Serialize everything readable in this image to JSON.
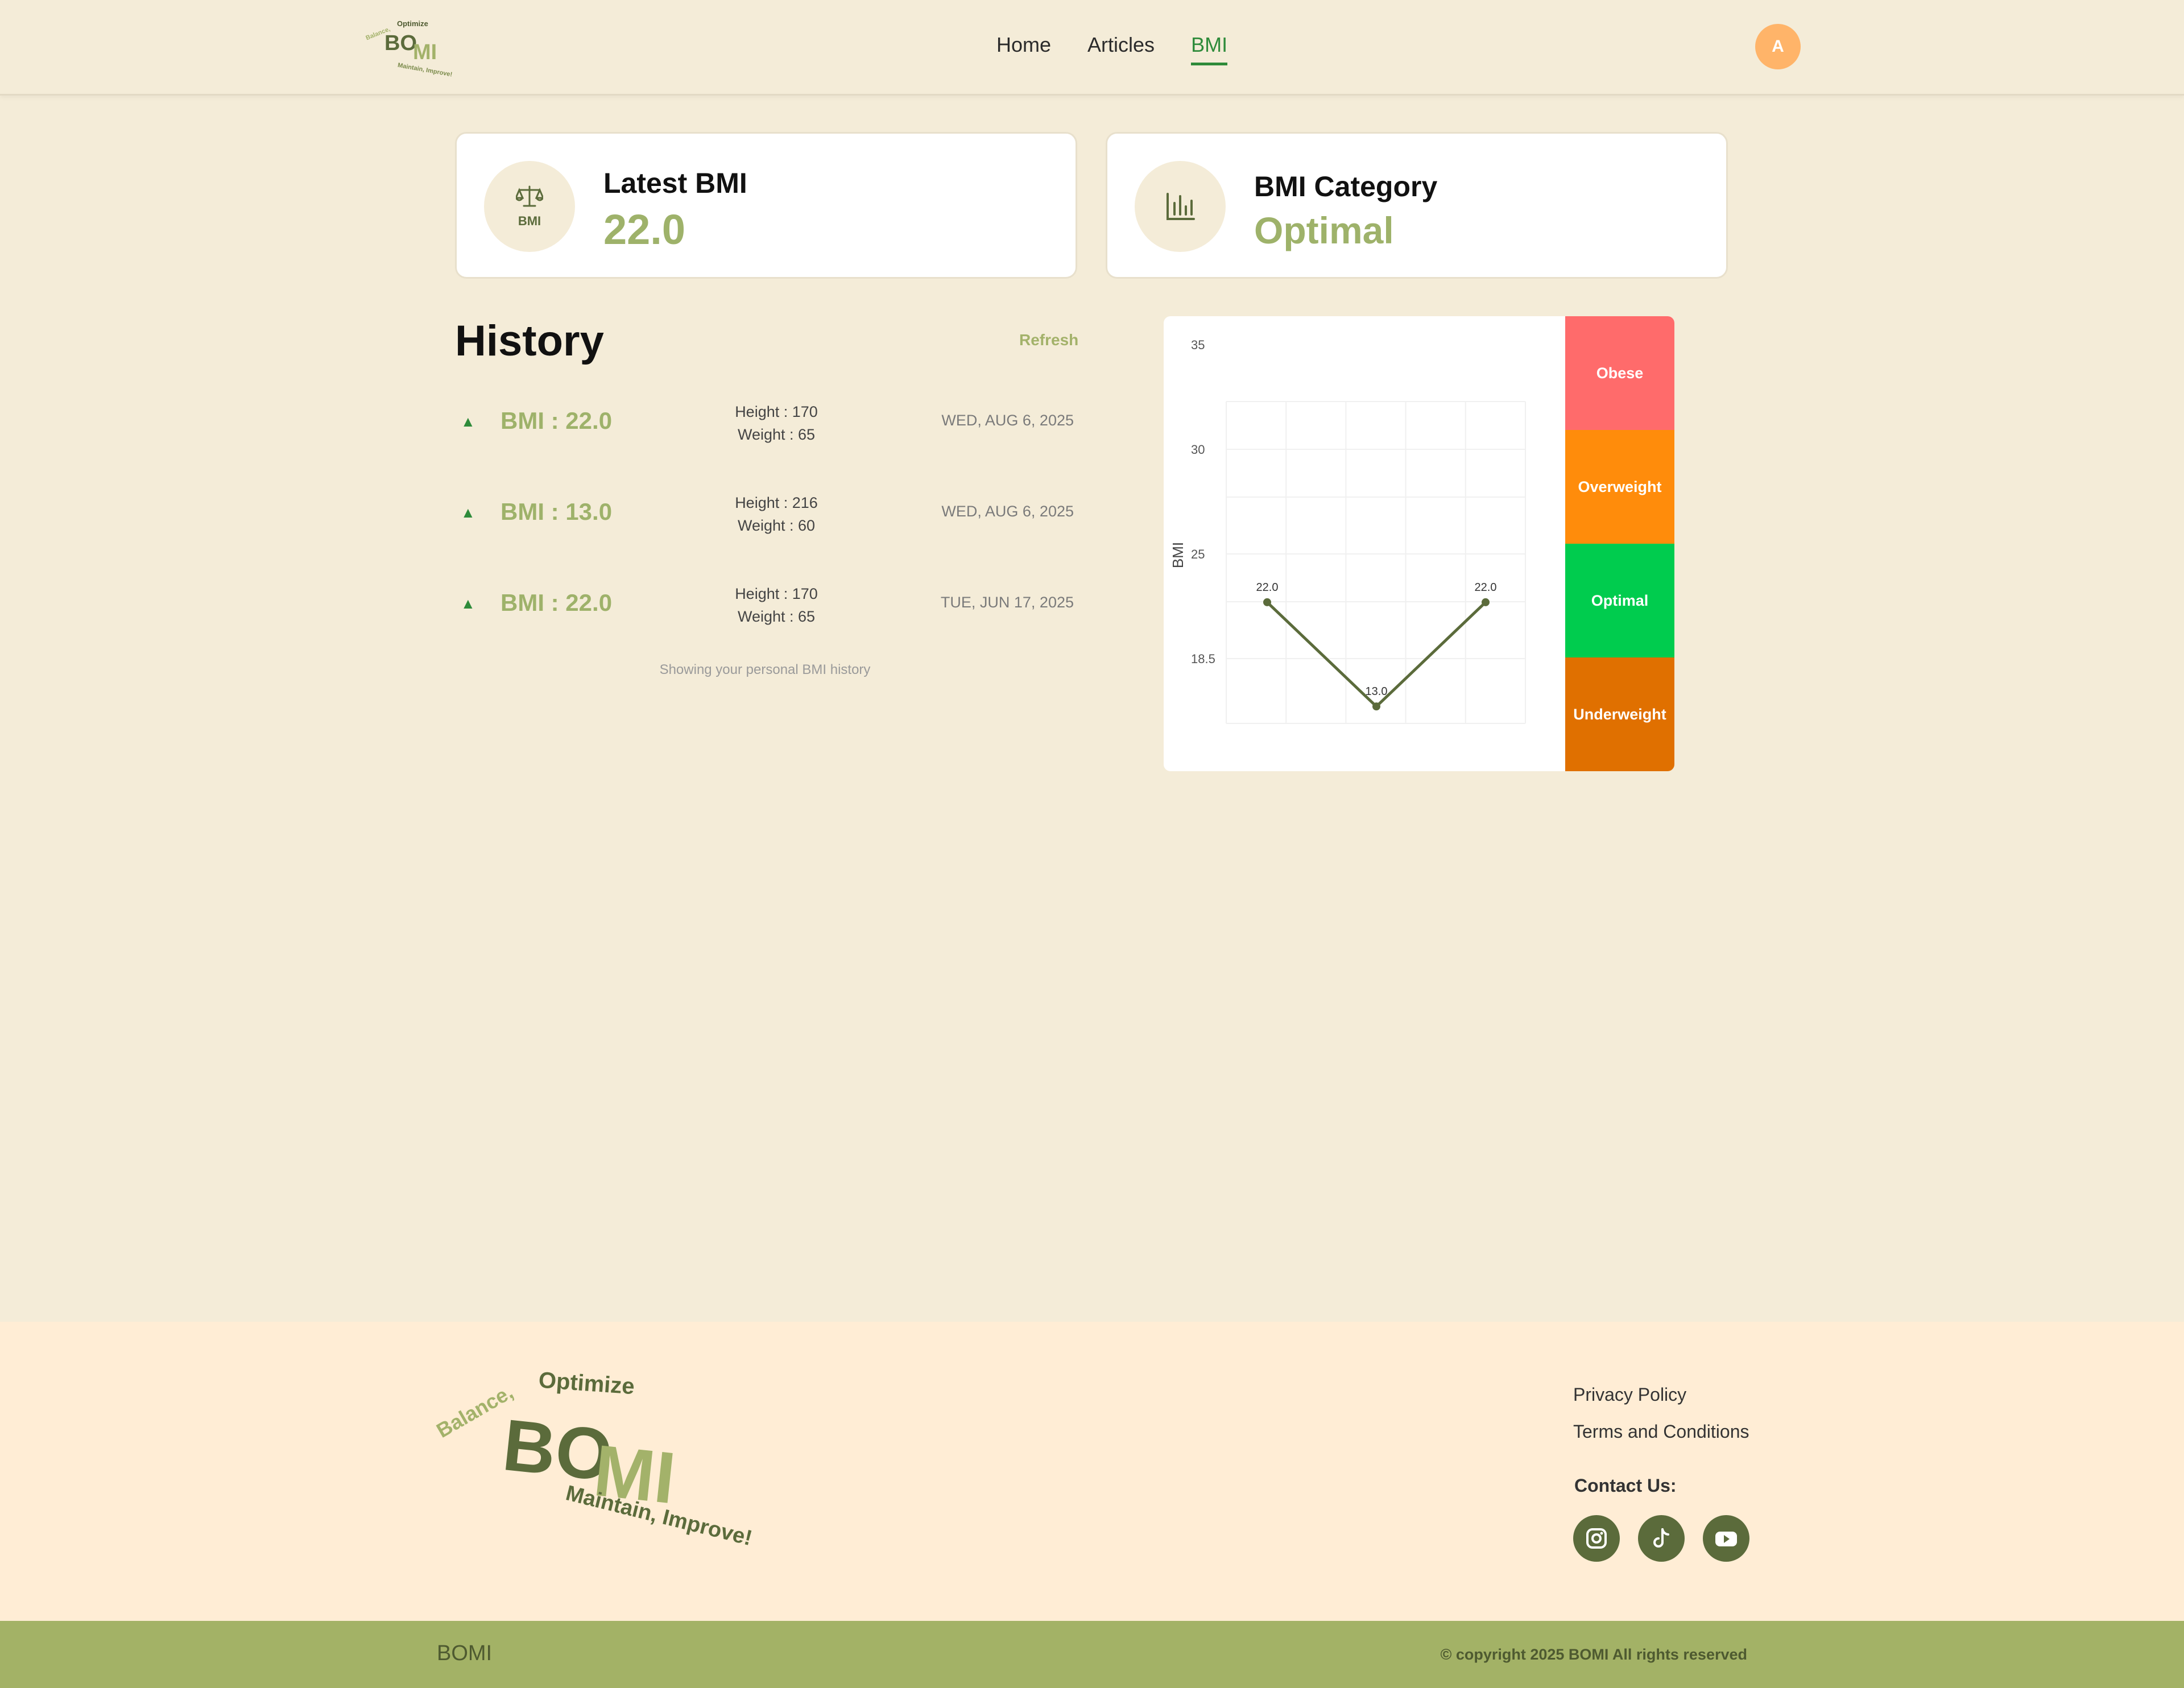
{
  "header": {
    "logo": {
      "top": "Optimize",
      "left": "Balance,",
      "main_a": "BO",
      "main_b": "MI",
      "bottom": "Maintain, Improve!"
    },
    "nav": [
      {
        "label": "Home",
        "active": false
      },
      {
        "label": "Articles",
        "active": false
      },
      {
        "label": "BMI",
        "active": true
      }
    ],
    "avatar_initial": "A"
  },
  "cards": {
    "latest": {
      "icon": "scale-icon",
      "icon_label": "BMI",
      "title": "Latest BMI",
      "value": "22.0"
    },
    "category": {
      "icon": "bar-chart-icon",
      "title": "BMI Category",
      "value": "Optimal"
    }
  },
  "history": {
    "title": "History",
    "refresh_label": "Refresh",
    "items": [
      {
        "bmi": "BMI : 22.0",
        "height": "Height : 170",
        "weight": "Weight : 65",
        "date": "WED, AUG 6, 2025"
      },
      {
        "bmi": "BMI : 13.0",
        "height": "Height : 216",
        "weight": "Weight : 60",
        "date": "WED, AUG 6, 2025"
      },
      {
        "bmi": "BMI : 22.0",
        "height": "Height : 170",
        "weight": "Weight : 65",
        "date": "TUE, JUN 17, 2025"
      }
    ],
    "note": "Showing your personal BMI history"
  },
  "chart_data": {
    "type": "line",
    "ylabel": "BMI",
    "y_ticks": [
      18.5,
      25,
      30,
      35
    ],
    "ylim": [
      10,
      35
    ],
    "series": [
      {
        "values": [
          22.0,
          13.0,
          22.0
        ],
        "labels": [
          "22.0",
          "13.0",
          "22.0"
        ]
      }
    ],
    "bands": [
      {
        "label": "Obese",
        "color": "#ff6b6b"
      },
      {
        "label": "Overweight",
        "color": "#ff8c0b"
      },
      {
        "label": "Optimal",
        "color": "#00cc4e"
      },
      {
        "label": "Underweight",
        "color": "#e07000"
      }
    ],
    "line_color": "#5b6b3b",
    "grid": true
  },
  "footer": {
    "logo": {
      "top": "Optimize",
      "left": "Balance,",
      "main_a": "BO",
      "main_b": "MI",
      "bottom": "Maintain, Improve!"
    },
    "links": [
      "Privacy Policy",
      "Terms and Conditions"
    ],
    "contact_label": "Contact Us:",
    "socials": [
      "instagram-icon",
      "tiktok-icon",
      "youtube-icon"
    ],
    "brand": "BOMI",
    "copyright": "© copyright 2025 BOMI All rights reserved"
  },
  "colors": {
    "accent": "#9eb26a",
    "dark_green": "#5b6b3b",
    "nav_active": "#2e8b3a",
    "avatar": "#ffb469"
  }
}
